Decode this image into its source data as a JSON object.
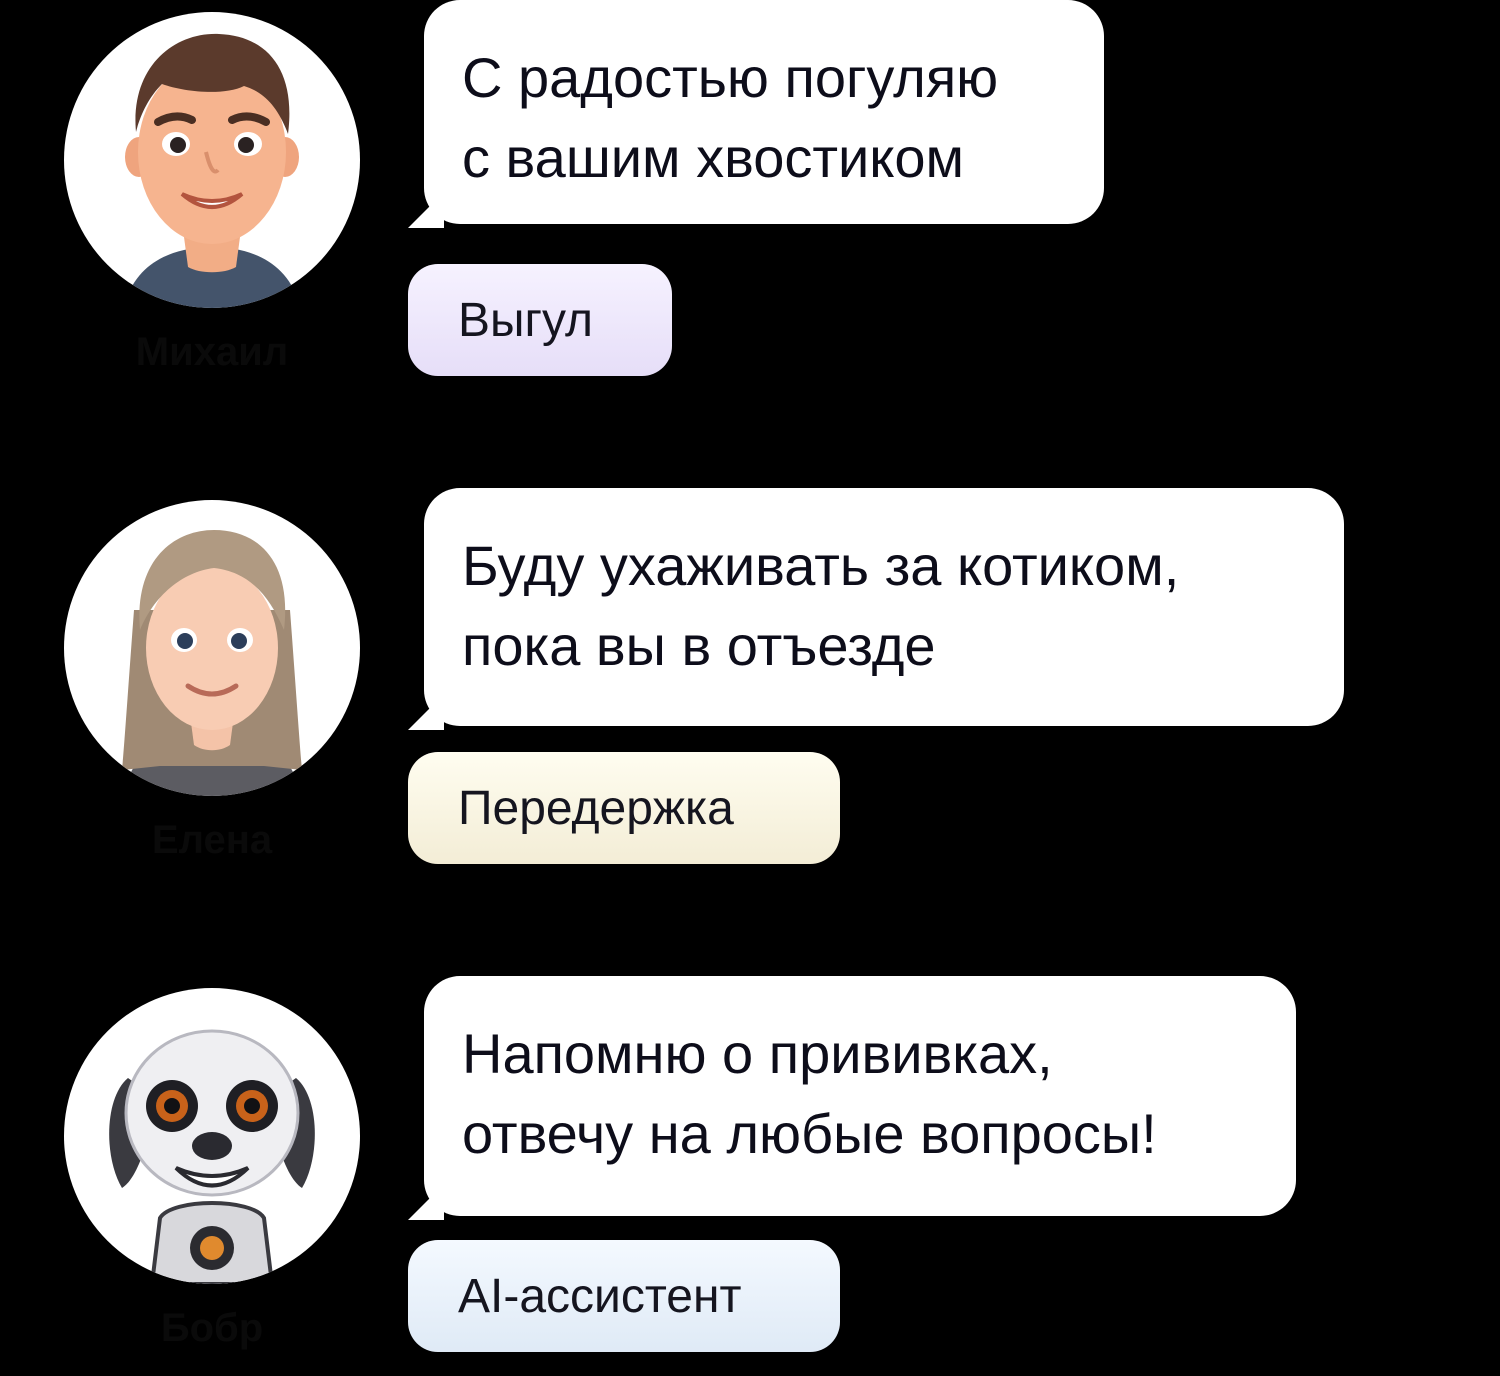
{
  "cards": [
    {
      "author": "Михаил",
      "avatar_icon": "man-avatar-icon",
      "message_lines": [
        "С радостью погуляю",
        "с вашим хвостиком"
      ],
      "tag": "Выгул",
      "tag_color": "#e9e2fb"
    },
    {
      "author": "Елена",
      "avatar_icon": "woman-avatar-icon",
      "message_lines": [
        "Буду ухаживать за котиком,",
        "пока вы в отъезде"
      ],
      "tag": "Передержка",
      "tag_color": "#f5efd9"
    },
    {
      "author": "Бобр",
      "avatar_icon": "robot-dog-avatar-icon",
      "message_lines": [
        "Напомню о прививках,",
        "отвечу на любые вопросы!"
      ],
      "tag": "AI-ассистент",
      "tag_color": "#e2ecf7"
    }
  ]
}
